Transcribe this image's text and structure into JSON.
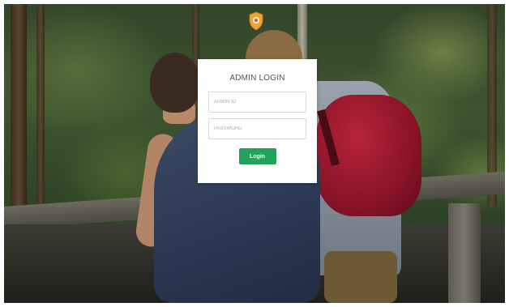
{
  "login": {
    "title": "ADMIN LOGIN",
    "admin_id_placeholder": "ADMIN ID",
    "admin_id_value": "",
    "password_placeholder": "PASSWORD",
    "password_value": "",
    "login_label": "Login"
  },
  "brand": {
    "logo_icon": "shield-icon",
    "logo_color": "#f2a233"
  },
  "colors": {
    "login_button": "#21a35a",
    "card_background": "#ffffff"
  }
}
